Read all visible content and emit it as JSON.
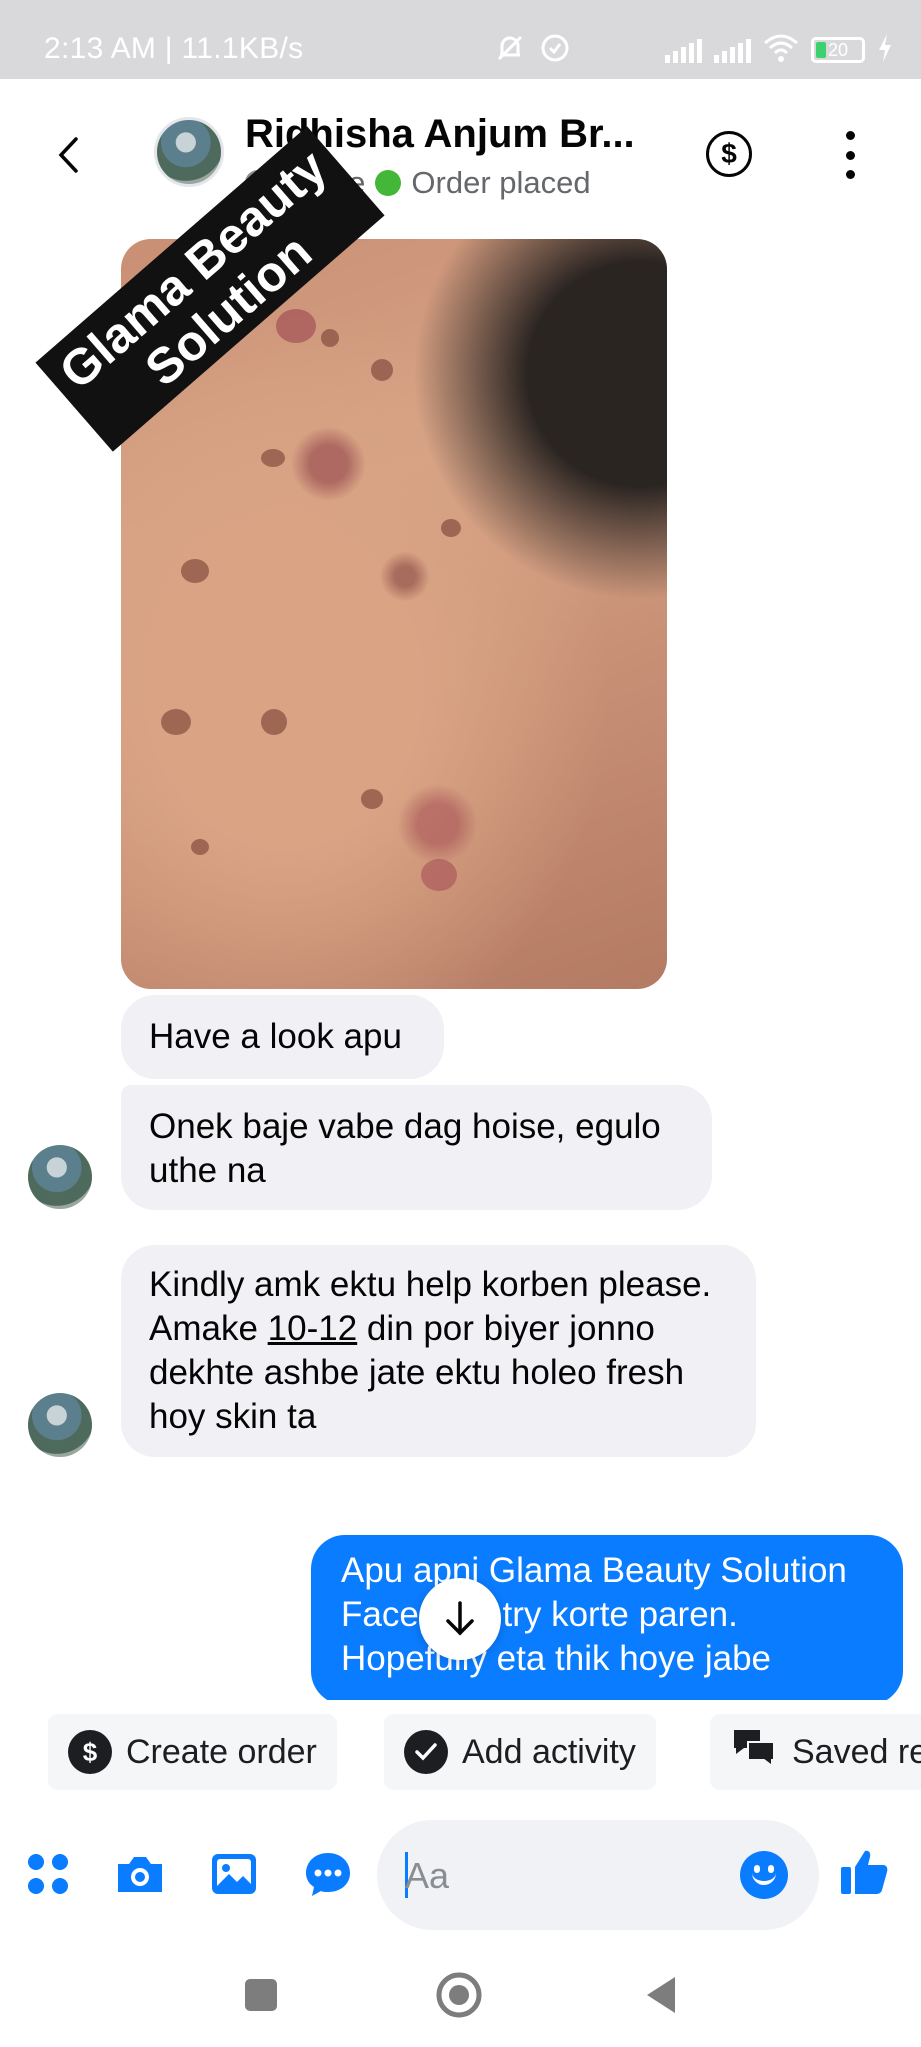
{
  "status_bar": {
    "time_and_speed": "2:13 AM | 11.1KB/s",
    "battery_level": "20"
  },
  "header": {
    "contact_name": "Ridhisha Anjum Br...",
    "status_muted": "Active",
    "status_text": "Order placed",
    "status_color": "#44b738"
  },
  "watermark": {
    "line1": "Glama Beauty",
    "line2": "Solution"
  },
  "messages": [
    {
      "direction": "incoming",
      "text": "Have a look apu"
    },
    {
      "direction": "incoming",
      "text": "Onek baje vabe dag hoise, egulo uthe na"
    },
    {
      "direction": "incoming",
      "text_before": "Kindly amk ektu help korben please. Amake ",
      "underlined": "10-12",
      "text_after": " din por biyer jonno dekhte ashbe jate ektu holeo fresh hoy skin ta"
    },
    {
      "direction": "outgoing",
      "text": "Apu apni Glama Beauty Solution Facepack try korte paren. Hopefully eta thik hoye jabe"
    }
  ],
  "quick_actions": [
    {
      "label": "Create order",
      "icon": "dollar-icon"
    },
    {
      "label": "Add activity",
      "icon": "check-circle-icon"
    },
    {
      "label": "Saved re",
      "icon": "saved-replies-icon"
    }
  ],
  "composer": {
    "placeholder": "Aa",
    "tools": [
      "apps-icon",
      "camera-icon",
      "gallery-icon",
      "chat-bubble-icon",
      "emoji-icon",
      "like-icon"
    ]
  },
  "colors": {
    "accent": "#0a7cff",
    "incoming_bubble": "#f0f0f5",
    "outgoing_bubble": "#0a7cff"
  }
}
